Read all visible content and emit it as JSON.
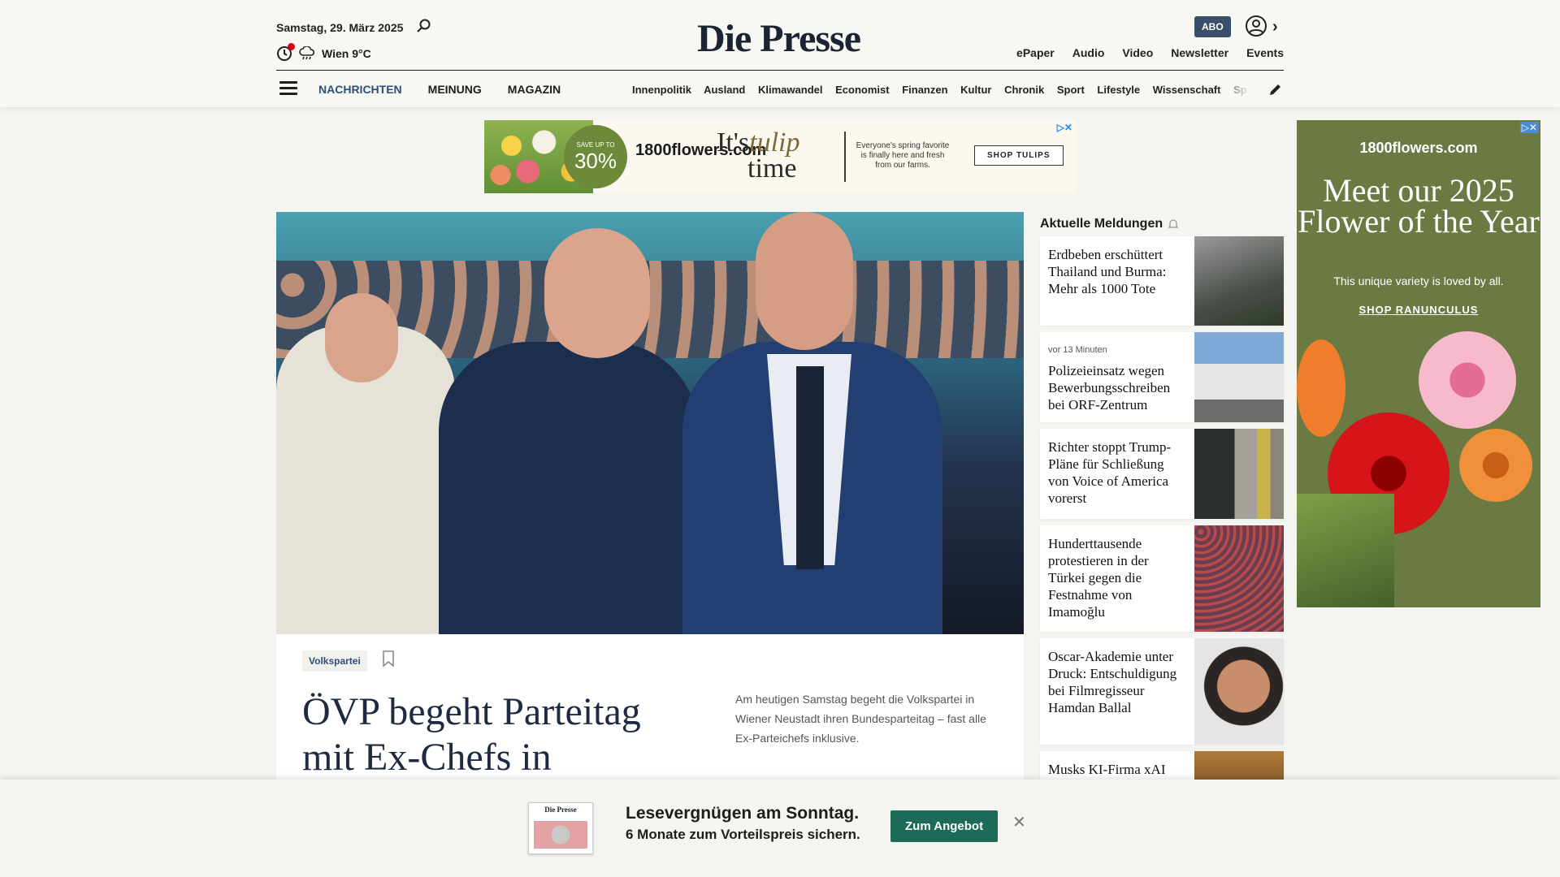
{
  "header": {
    "date": "Samstag, 29. März 2025",
    "weather": "Wien 9°C",
    "logo": "Die Presse",
    "abo": "ABO",
    "top_links": [
      "ePaper",
      "Audio",
      "Video",
      "Newsletter",
      "Events"
    ],
    "main_nav": [
      "NACHRICHTEN",
      "MEINUNG",
      "MAGAZIN"
    ],
    "sub_nav": [
      "Innenpolitik",
      "Ausland",
      "Klimawandel",
      "Economist",
      "Finanzen",
      "Kultur",
      "Chronik",
      "Sport",
      "Lifestyle",
      "Wissenschaft",
      "Spectrum"
    ]
  },
  "banner_ad": {
    "save_small": "SAVE UP TO",
    "save_value": "30%",
    "brand": "1800flowers.com",
    "tagline_a": "It's",
    "tagline_b": "tulip",
    "tagline_c": "time",
    "copy": "Everyone's spring favorite is finally here and fresh from our farms.",
    "button": "SHOP TULIPS"
  },
  "hero": {
    "tag": "Volkspartei",
    "headline": "ÖVP begeht Parteitag mit Ex-Chefs in",
    "teaser": "Am heutigen Samstag begeht die Volkspartei in Wiener Neustadt ihren Bundesparteitag – fast alle Ex-Parteichefs inklusive."
  },
  "aktuell": {
    "title": "Aktuelle Meldungen",
    "items": [
      {
        "time": "",
        "text": "Erdbeben erschüttert Thailand und Burma: Mehr als 1000 Tote"
      },
      {
        "time": "vor 13 Minuten",
        "text": "Polizeieinsatz wegen Bewerbungsschreiben bei ORF-Zentrum"
      },
      {
        "time": "",
        "text": "Richter stoppt Trump-Pläne für Schließung von Voice of America vorerst"
      },
      {
        "time": "",
        "text": "Hunderttausende protestieren in der Türkei gegen die Festnahme von Imamoğlu"
      },
      {
        "time": "",
        "text": "Oscar-Akademie unter Druck: Entschuldigung bei Filmregisseur Hamdan Ballal"
      },
      {
        "time": "",
        "text": "Musks KI-Firma xAI"
      }
    ]
  },
  "sky_ad": {
    "brand": "1800flowers.com",
    "headline": "Meet our 2025 Flower of the Year",
    "sub": "This unique variety is loved by all.",
    "link": "SHOP RANUNCULUS"
  },
  "sticky": {
    "paper_mast": "Die Presse",
    "line1": "Lesevergnügen am Sonntag.",
    "line2": "6 Monate zum Vorteilspreis sichern.",
    "cta": "Zum Angebot"
  }
}
